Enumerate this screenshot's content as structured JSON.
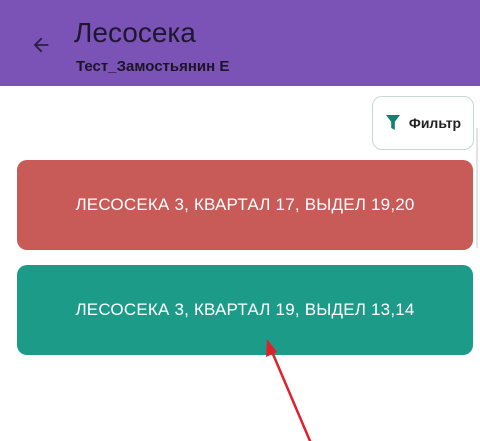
{
  "app_bar": {
    "title": "Лесосека",
    "subtitle": "Тест_Замостьянин Е",
    "back_icon": "arrow-left-icon"
  },
  "toolbar": {
    "filter_label": "Фильтр",
    "filter_icon": "funnel-icon"
  },
  "areas": [
    {
      "label": "ЛЕСОСЕКА 3, КВАРТАЛ 17, ВЫДЕЛ 19,20",
      "color": "#c85a57"
    },
    {
      "label": "ЛЕСОСЕКА 3, КВАРТАЛ 19, ВЫДЕЛ 13,14",
      "color": "#1c9c88"
    }
  ],
  "colors": {
    "app_bar": "#7b52b5",
    "filter_icon": "#12806f",
    "annotation_arrow": "#e0202a"
  }
}
